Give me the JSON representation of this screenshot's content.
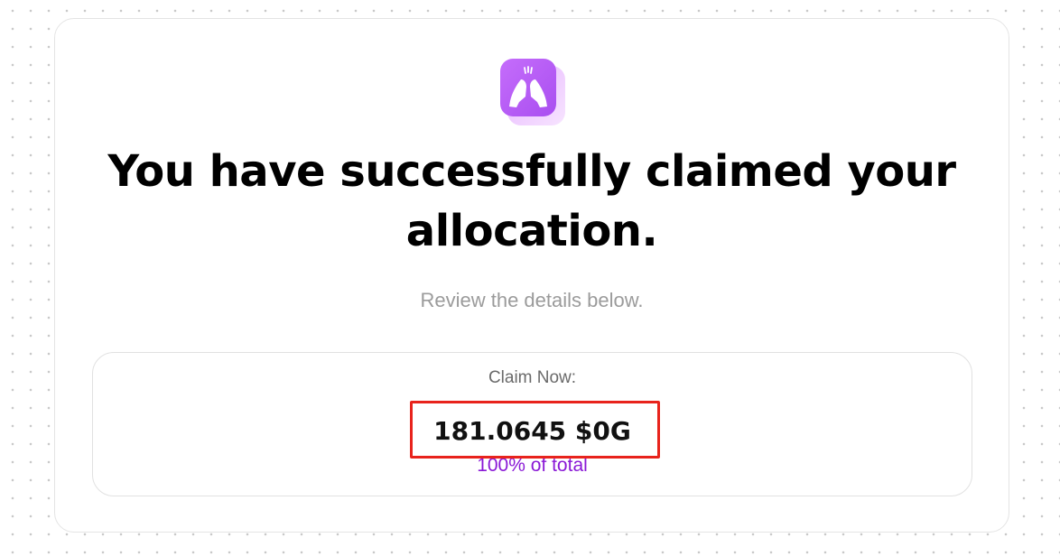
{
  "headline": "You have successfully claimed your allocation.",
  "subtitle": "Review the details below.",
  "claim": {
    "label": "Claim Now:",
    "amount": "181.0645 $0G",
    "percent": "100% of total"
  },
  "icon": "praising-hands-icon",
  "colors": {
    "accent_purple": "#8a19d6",
    "icon_purple": "#b657f5",
    "highlight_red": "#e8231c"
  }
}
